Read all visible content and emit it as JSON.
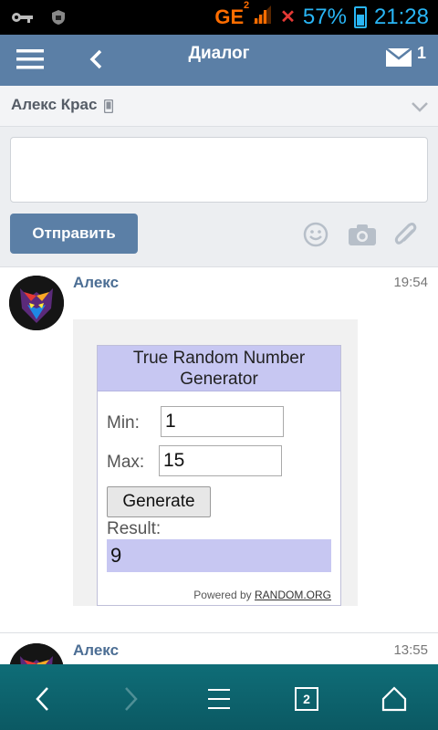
{
  "status_bar": {
    "network": "GE",
    "network_sup": "2",
    "battery_percent": "57%",
    "battery_level": 0.57,
    "time": "21:28",
    "icons": [
      "key-icon",
      "lock-icon",
      "signal-icon",
      "no-signal-icon",
      "battery-icon"
    ]
  },
  "app_bar": {
    "title": "Диалог",
    "mail_count": "1",
    "icons": [
      "menu-icon",
      "back-arrow-icon",
      "mail-icon"
    ]
  },
  "conversation": {
    "contact_name": "Алекс Крас",
    "icons": [
      "mobile-icon",
      "chevron-down-icon"
    ]
  },
  "composer": {
    "input_value": "",
    "input_placeholder": "",
    "send_label": "Отправить",
    "icons": [
      "smile-icon",
      "camera-icon",
      "paperclip-icon"
    ]
  },
  "messages": [
    {
      "author": "Алекс",
      "time": "19:54",
      "attachment": {
        "title_line1": "True Random Number",
        "title_line2": "Generator",
        "min_label": "Min:",
        "min_value": "1",
        "max_label": "Max:",
        "max_value": "15",
        "generate_label": "Generate",
        "result_label": "Result:",
        "result_value": "9",
        "powered_prefix": "Powered by",
        "powered_link": "RANDOM.ORG"
      }
    },
    {
      "author": "Алекс",
      "time": "13:55"
    }
  ],
  "nav_bar": {
    "tab_count": "2",
    "icons": [
      "back-icon",
      "forward-icon",
      "menu-icon",
      "tabs-icon",
      "home-icon"
    ]
  },
  "colors": {
    "app_bar": "#5b7fa6",
    "accent_blue": "#29b6f6",
    "nav_bar": "#0f6d77",
    "rng_header": "#c7c7f2"
  }
}
